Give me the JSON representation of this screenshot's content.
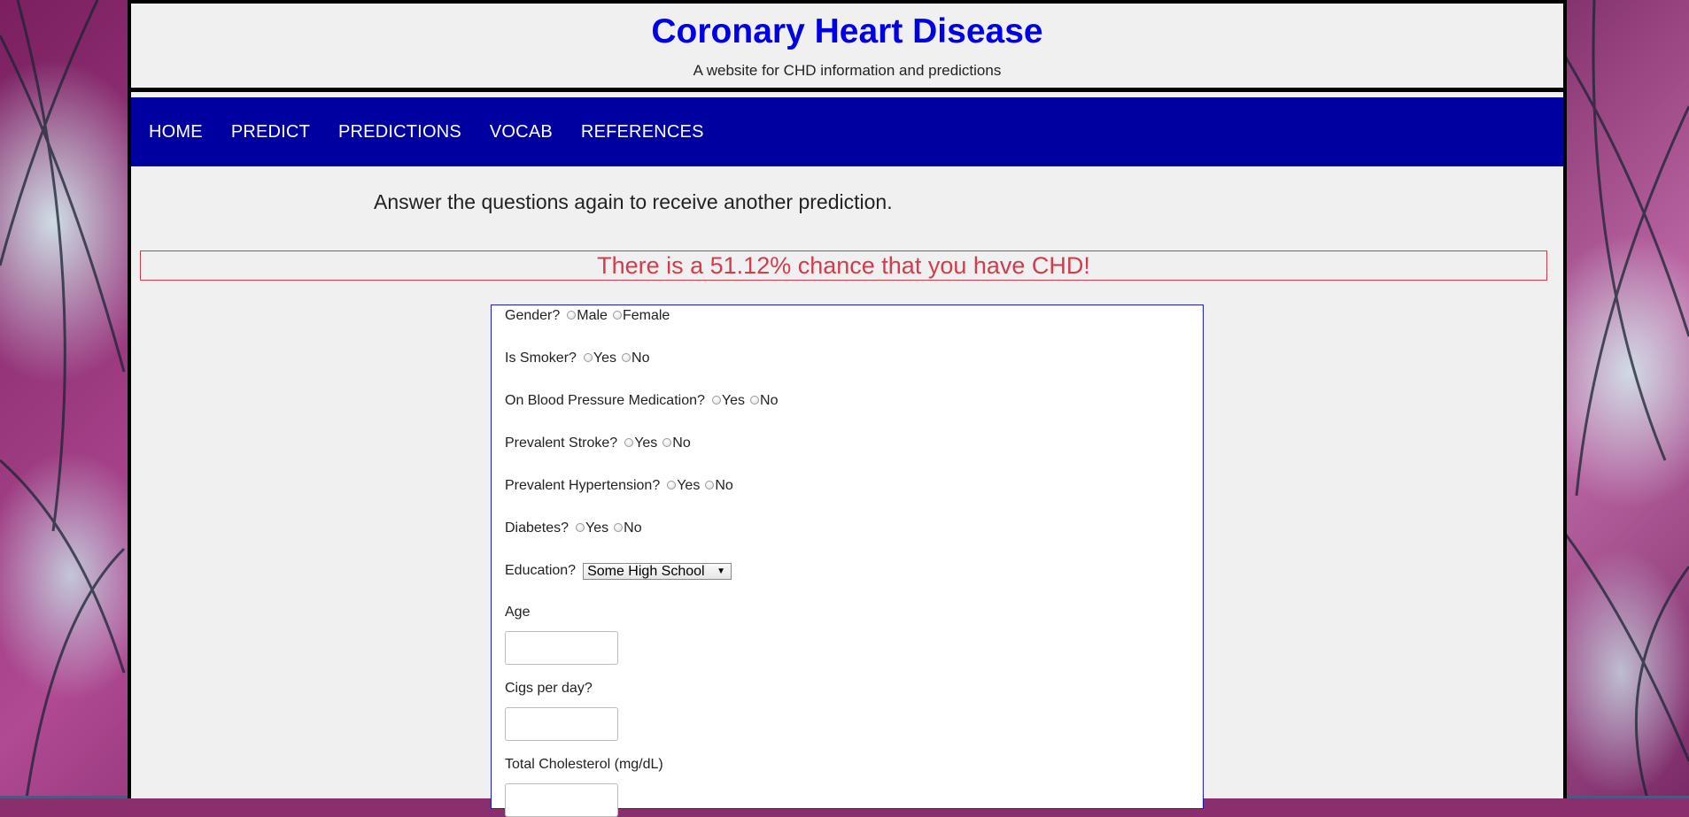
{
  "header": {
    "title": "Coronary Heart Disease",
    "subtitle": "A website for CHD information and predictions"
  },
  "nav": {
    "items": [
      "HOME",
      "PREDICT",
      "PREDICTIONS",
      "VOCAB",
      "REFERENCES"
    ]
  },
  "main": {
    "intro": "Answer the questions again to receive another prediction.",
    "result": "There is a 51.12% chance that you have CHD!"
  },
  "form": {
    "gender": {
      "label": "Gender?",
      "options": [
        "Male",
        "Female"
      ]
    },
    "smoker": {
      "label": "Is Smoker?",
      "options": [
        "Yes",
        "No"
      ]
    },
    "bp_meds": {
      "label": "On Blood Pressure Medication?",
      "options": [
        "Yes",
        "No"
      ]
    },
    "stroke": {
      "label": "Prevalent Stroke?",
      "options": [
        "Yes",
        "No"
      ]
    },
    "hypertension": {
      "label": "Prevalent Hypertension?",
      "options": [
        "Yes",
        "No"
      ]
    },
    "diabetes": {
      "label": "Diabetes?",
      "options": [
        "Yes",
        "No"
      ]
    },
    "education": {
      "label": "Education?",
      "selected": "Some High School"
    },
    "age": {
      "label": "Age",
      "value": ""
    },
    "cigs": {
      "label": "Cigs per day?",
      "value": ""
    },
    "cholesterol": {
      "label": "Total Cholesterol (mg/dL)",
      "value": ""
    }
  },
  "colors": {
    "title": "#0000e6",
    "nav_bg": "#0000a0",
    "result": "#d23c4c",
    "form_border": "#1b1bc8"
  }
}
